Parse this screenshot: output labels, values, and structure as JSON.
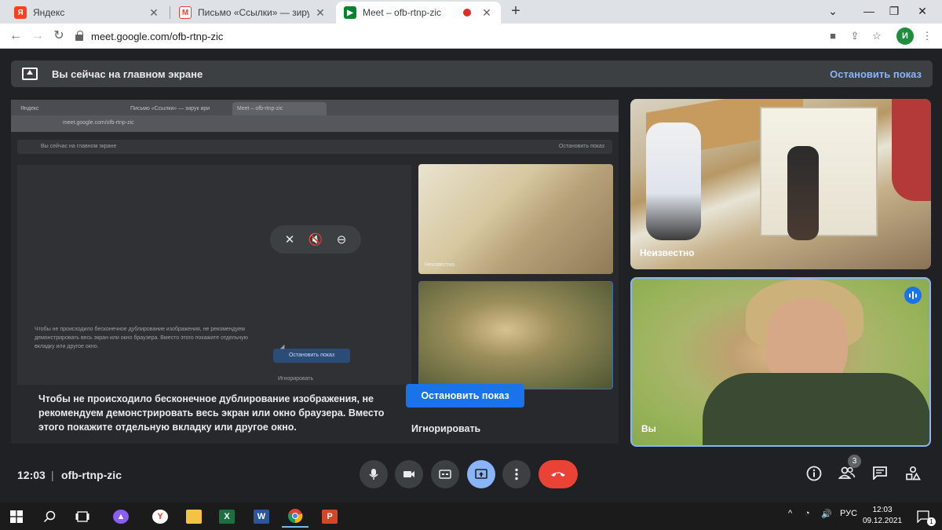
{
  "browser": {
    "tabs": [
      {
        "title": "Яндекс",
        "icon": "yandex-icon",
        "color": "#fc3f1d",
        "glyph": "Я"
      },
      {
        "title": "Письмо «Ссылки» — зирук ири",
        "icon": "gmail-icon",
        "color": "#ea4335",
        "glyph": "M"
      },
      {
        "title": "Meet – ofb-rtnp-zic",
        "icon": "meet-icon",
        "color": "#00832d",
        "glyph": "▶"
      }
    ],
    "url": "meet.google.com/ofb-rtnp-zic",
    "profile_initial": "И"
  },
  "banner": {
    "text": "Вы сейчас на главном экране",
    "stop_label": "Остановить показ"
  },
  "shared_screen": {
    "mini_tabs": [
      "Яндекс",
      "Письмо «Ссылки» — зирук ири",
      "Meet – ofb-rtnp-zic"
    ],
    "mini_url": "meet.google.com/ofb-rtnp-zic",
    "mini_banner": "Вы сейчас на главном экране",
    "mini_banner_stop": "Остановить показ",
    "mini_tile_label": "Неизвестно",
    "mini_warning": "Чтобы не происходило бесконечное дублирование изображения, не рекомендуем демонстрировать весь экран или окно браузера. Вместо этого покажите отдельную вкладку или другое окно.",
    "mini_stop": "Остановить показ",
    "mini_ignore": "Игнорировать"
  },
  "dialog": {
    "warning": "Чтобы не происходило бесконечное дублирование изображения, не рекомендуем демонстрировать весь экран или окно браузера. Вместо этого покажите отдельную вкладку или другое окно.",
    "stop_button": "Остановить показ",
    "ignore_button": "Игнорировать"
  },
  "participants": [
    {
      "name": "Неизвестно",
      "speaking": false
    },
    {
      "name": "Вы",
      "speaking": true
    }
  ],
  "meeting": {
    "time": "12:03",
    "code": "ofb-rtnp-zic",
    "participant_count": "3"
  },
  "taskbar": {
    "lang": "РУС",
    "time": "12:03",
    "date": "09.12.2021",
    "notifications": "1"
  },
  "colors": {
    "accent": "#1a73e8",
    "hangup": "#ea4335",
    "link": "#8ab4f8"
  }
}
